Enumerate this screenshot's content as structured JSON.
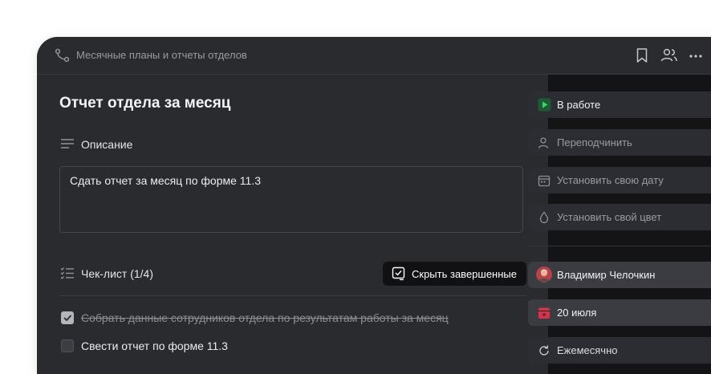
{
  "window": {
    "title": "Месячные планы и отчеты отделов",
    "icons": [
      "route-icon",
      "bookmark-icon",
      "users-icon",
      "more-icon"
    ]
  },
  "task": {
    "title": "Отчет отдела за месяц",
    "description_label": "Описание",
    "description_text": "Сдать отчет за месяц по форме 11.3"
  },
  "checklist": {
    "label": "Чек-лист (1/4)",
    "hide_button_label": "Скрыть завершенные",
    "items": [
      {
        "text": "Собрать данные сотрудников отдела по результатам работы за месяц",
        "done": true
      },
      {
        "text": "Свести отчет по форме 11.3",
        "done": false
      }
    ]
  },
  "sidebar": {
    "status": {
      "label": "В работе",
      "color": "#2e9e4d"
    },
    "reassign": {
      "label": "Переподчинить"
    },
    "set_date": {
      "label": "Установить свою дату"
    },
    "set_color": {
      "label": "Установить свой цвет"
    },
    "assignee": {
      "name": "Владимир Челочкин"
    },
    "due_date": {
      "label": "20 июля",
      "color": "#d8334a"
    },
    "repeat": {
      "label": "Ежемесячно"
    }
  }
}
